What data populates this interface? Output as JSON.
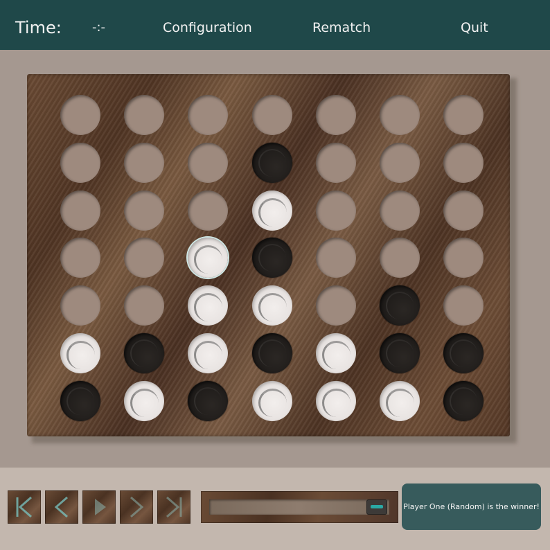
{
  "header": {
    "time_label": "Time:",
    "time_value": "-:-",
    "configuration_label": "Configuration",
    "rematch_label": "Rematch",
    "quit_label": "Quit",
    "bar_color": "#1f4849"
  },
  "board": {
    "columns": 7,
    "rows": 7,
    "cells": [
      [
        "empty",
        "empty",
        "empty",
        "empty",
        "empty",
        "empty",
        "empty"
      ],
      [
        "empty",
        "empty",
        "empty",
        "black",
        "empty",
        "empty",
        "empty"
      ],
      [
        "empty",
        "empty",
        "empty",
        "white",
        "empty",
        "empty",
        "empty"
      ],
      [
        "empty",
        "empty",
        "white",
        "black",
        "empty",
        "empty",
        "empty"
      ],
      [
        "empty",
        "empty",
        "white",
        "white",
        "empty",
        "black",
        "empty"
      ],
      [
        "white",
        "black",
        "white",
        "black",
        "white",
        "black",
        "black"
      ],
      [
        "black",
        "white",
        "black",
        "white",
        "white",
        "white",
        "black"
      ]
    ],
    "highlighted": [
      [
        3,
        2
      ]
    ]
  },
  "playback": {
    "buttons": [
      "first-move-icon",
      "previous-move-icon",
      "play-icon",
      "next-move-icon",
      "last-move-icon"
    ],
    "progress": 1.0
  },
  "status": {
    "message": "Player One (Random) is the winner!"
  }
}
